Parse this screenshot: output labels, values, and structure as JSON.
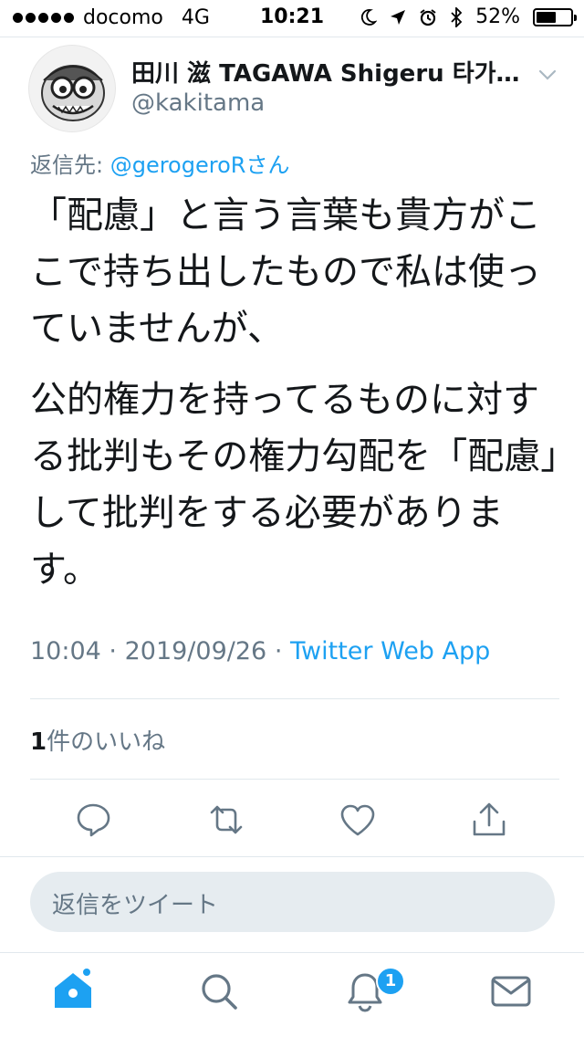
{
  "status_bar": {
    "carrier": "docomo",
    "network": "4G",
    "time": "10:21",
    "battery": "52%",
    "battery_level": 0.52
  },
  "tweet": {
    "author_name": "田川 滋 TAGAWA Shigeru 타가…",
    "author_handle": "@kakitama",
    "reply_prefix": "返信先: ",
    "reply_to": "@gerogeroRさん",
    "paragraph_1": "「配慮」と言う言葉も貴方がここで持ち出したもので私は使っていませんが、",
    "paragraph_2": "公的権力を持ってるものに対する批判もその権力勾配を「配慮」して批判をする必要があります。",
    "time": "10:04",
    "separator": "·",
    "date": "2019/09/26",
    "source": "Twitter Web App",
    "likes_count": "1",
    "likes_label": "件のいいね"
  },
  "reply_placeholder": "返信をツイート",
  "notifications_badge": "1",
  "accent_color": "#1da1f2"
}
